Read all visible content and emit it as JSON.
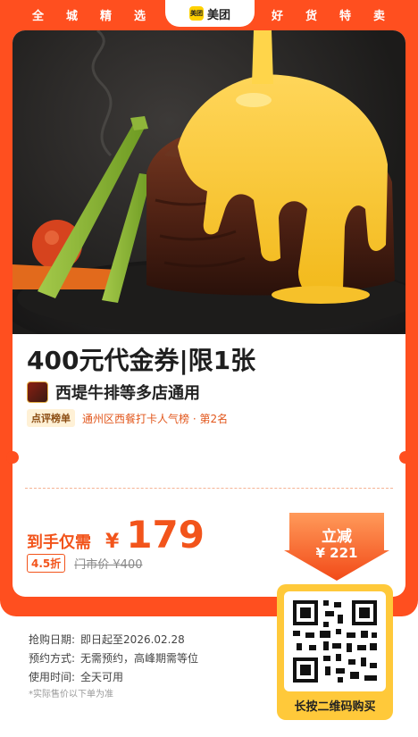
{
  "top_bar": {
    "left_items": [
      "全",
      "城",
      "精",
      "选"
    ],
    "right_items": [
      "好",
      "货",
      "特",
      "卖"
    ],
    "logo_badge": "美团",
    "logo_text": "美团"
  },
  "deal": {
    "title": "400元代金券|限1张",
    "shop": "西堤牛排等多店通用",
    "rank_badge": "点评榜单",
    "rank_text": "通州区西餐打卡人气榜 · 第2名"
  },
  "price": {
    "label": "到手仅需",
    "currency": "¥",
    "value": "179",
    "discount": "4.5折",
    "original": "门市价 ¥400"
  },
  "save": {
    "label": "立减",
    "amount": "¥ 221"
  },
  "qr": {
    "label": "长按二维码购买"
  },
  "info": {
    "rows": [
      {
        "key": "抢购日期:",
        "value": "即日起至2026.02.28"
      },
      {
        "key": "预约方式:",
        "value": "无需预约，高峰期需等位"
      },
      {
        "key": "使用时间:",
        "value": "全天可用"
      }
    ],
    "note": "*实际售价以下单为准"
  },
  "colors": {
    "brand_orange": "#ff4f1f",
    "price_orange": "#f2541b",
    "meituan_yellow": "#ffd100",
    "qr_yellow": "#ffc93a"
  }
}
